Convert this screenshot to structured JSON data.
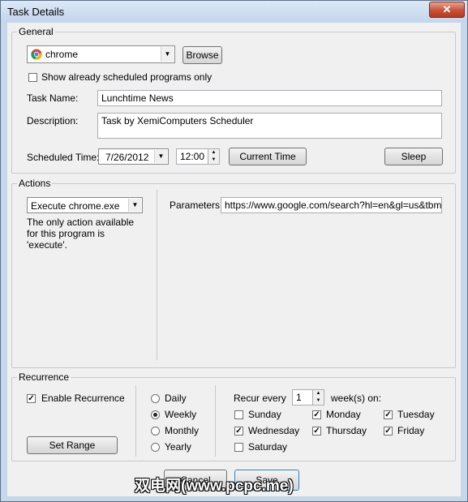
{
  "window": {
    "title": "Task Details",
    "close_glyph": "✕"
  },
  "general": {
    "label": "General",
    "program_value": "chrome",
    "program_icon": "chrome-icon",
    "browse_label": "Browse",
    "show_scheduled_label": "Show already scheduled programs only",
    "task_name_label": "Task Name:",
    "task_name_value": "Lunchtime News",
    "description_label": "Description:",
    "description_value": "Task by XemiComputers Scheduler",
    "scheduled_time_label": "Scheduled Time:",
    "date_value": "7/26/2012",
    "time_value": "12:00",
    "current_time_label": "Current Time",
    "sleep_label": "Sleep"
  },
  "actions": {
    "label": "Actions",
    "action_value": "Execute chrome.exe",
    "note": "The only action available for this program is 'execute'.",
    "parameters_label": "Parameters:",
    "parameters_value": "https://www.google.com/search?hl=en&gl=us&tbm=nws"
  },
  "recurrence": {
    "label": "Recurrence",
    "enable_label": "Enable Recurrence",
    "enable_checked": true,
    "set_range_label": "Set Range",
    "options": [
      {
        "label": "Daily",
        "selected": false
      },
      {
        "label": "Weekly",
        "selected": true
      },
      {
        "label": "Monthly",
        "selected": false
      },
      {
        "label": "Yearly",
        "selected": false
      }
    ],
    "recur_every_label": "Recur every",
    "recur_every_value": "1",
    "weeks_on_label": "week(s) on:",
    "days": [
      {
        "label": "Sunday",
        "checked": false
      },
      {
        "label": "Monday",
        "checked": true
      },
      {
        "label": "Tuesday",
        "checked": true
      },
      {
        "label": "Wednesday",
        "checked": true
      },
      {
        "label": "Thursday",
        "checked": true
      },
      {
        "label": "Friday",
        "checked": true
      },
      {
        "label": "Saturday",
        "checked": false
      }
    ]
  },
  "footer": {
    "cancel_label": "Cancel",
    "save_label": "Save"
  },
  "watermark": "双电网(www.pcpc.me)"
}
